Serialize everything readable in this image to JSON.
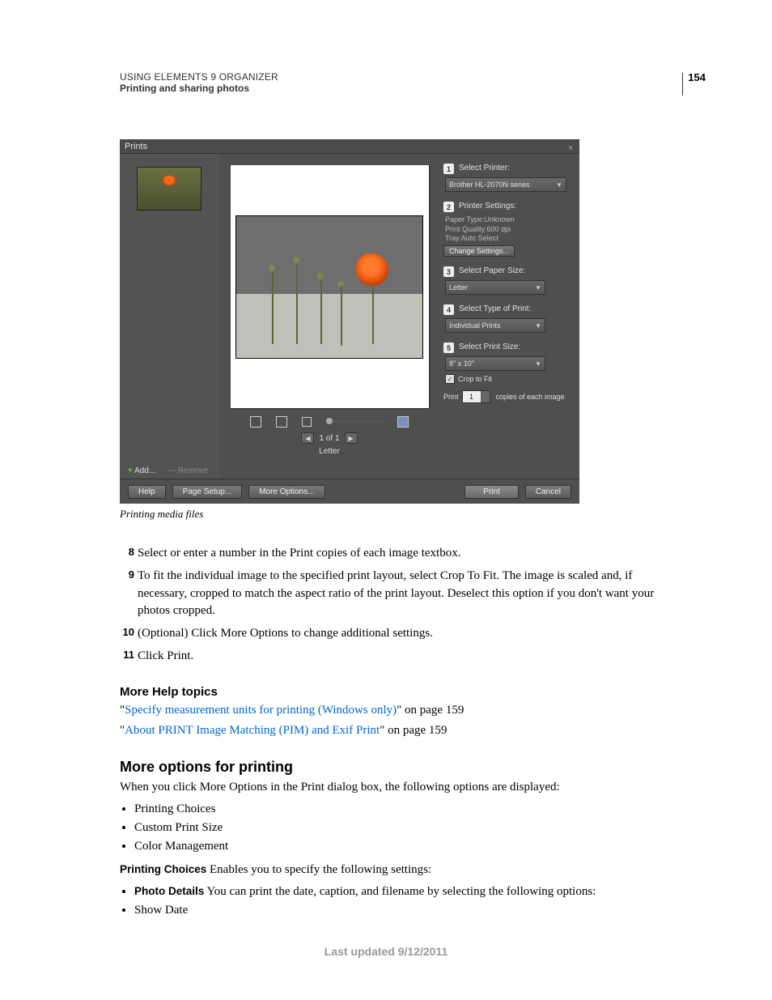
{
  "page_number": "154",
  "header_line1": "USING ELEMENTS 9 ORGANIZER",
  "header_line2": "Printing and sharing photos",
  "dialog": {
    "title": "Prints",
    "add": "Add...",
    "remove": "Remove",
    "nav_text": "1 of 1",
    "paper_label": "Letter",
    "step1_label": "Select Printer:",
    "printer_dd": "Brother HL-2070N series",
    "step2_label": "Printer Settings:",
    "s2_a": "Paper Type:Unknown",
    "s2_b": "Print Quality:600 dpi",
    "s2_c": "Tray Auto Select",
    "change_settings": "Change Settings...",
    "step3_label": "Select Paper Size:",
    "paper_dd": "Letter",
    "step4_label": "Select Type of Print:",
    "type_dd": "Individual Prints",
    "step5_label": "Select Print Size:",
    "size_dd": "8\" x 10\"",
    "crop": "Crop to Fit",
    "copies_pre": "Print",
    "copies_val": "1",
    "copies_post": "copies of each image",
    "btn_help": "Help",
    "btn_pagesetup": "Page Setup...",
    "btn_moreopt": "More Options...",
    "btn_print": "Print",
    "btn_cancel": "Cancel"
  },
  "caption": "Printing media files",
  "steps": {
    "n8": "8",
    "t8": "Select or enter a number in the Print copies of each image textbox.",
    "n9": "9",
    "t9": "To fit the individual image to the specified print layout, select Crop To Fit. The image is scaled and, if necessary, cropped to match the aspect ratio of the print layout. Deselect this option if you don't want your photos cropped.",
    "n10": "10",
    "t10": "(Optional) Click More Options to change additional settings.",
    "n11": "11",
    "t11": "Click Print."
  },
  "more_help_title": "More Help topics",
  "ref1_link": "Specify measurement units for printing (Windows only)",
  "ref1_suffix": "\" on page 159",
  "ref2_link": "About PRINT Image Matching (PIM) and Exif Print",
  "ref2_suffix": "\" on page 159",
  "section_title": "More options for printing",
  "intro": "When you click More Options in the Print dialog box, the following options are displayed:",
  "bullets1": {
    "a": "Printing Choices",
    "b": "Custom Print Size",
    "c": "Color Management"
  },
  "pc_label": "Printing Choices",
  "pc_text": "  Enables you to specify the following settings:",
  "pd_label": "Photo Details",
  "pd_text": "  You can print the date, caption, and filename by selecting the following options:",
  "bullet_showdate": "Show Date",
  "last_updated": "Last updated 9/12/2011"
}
